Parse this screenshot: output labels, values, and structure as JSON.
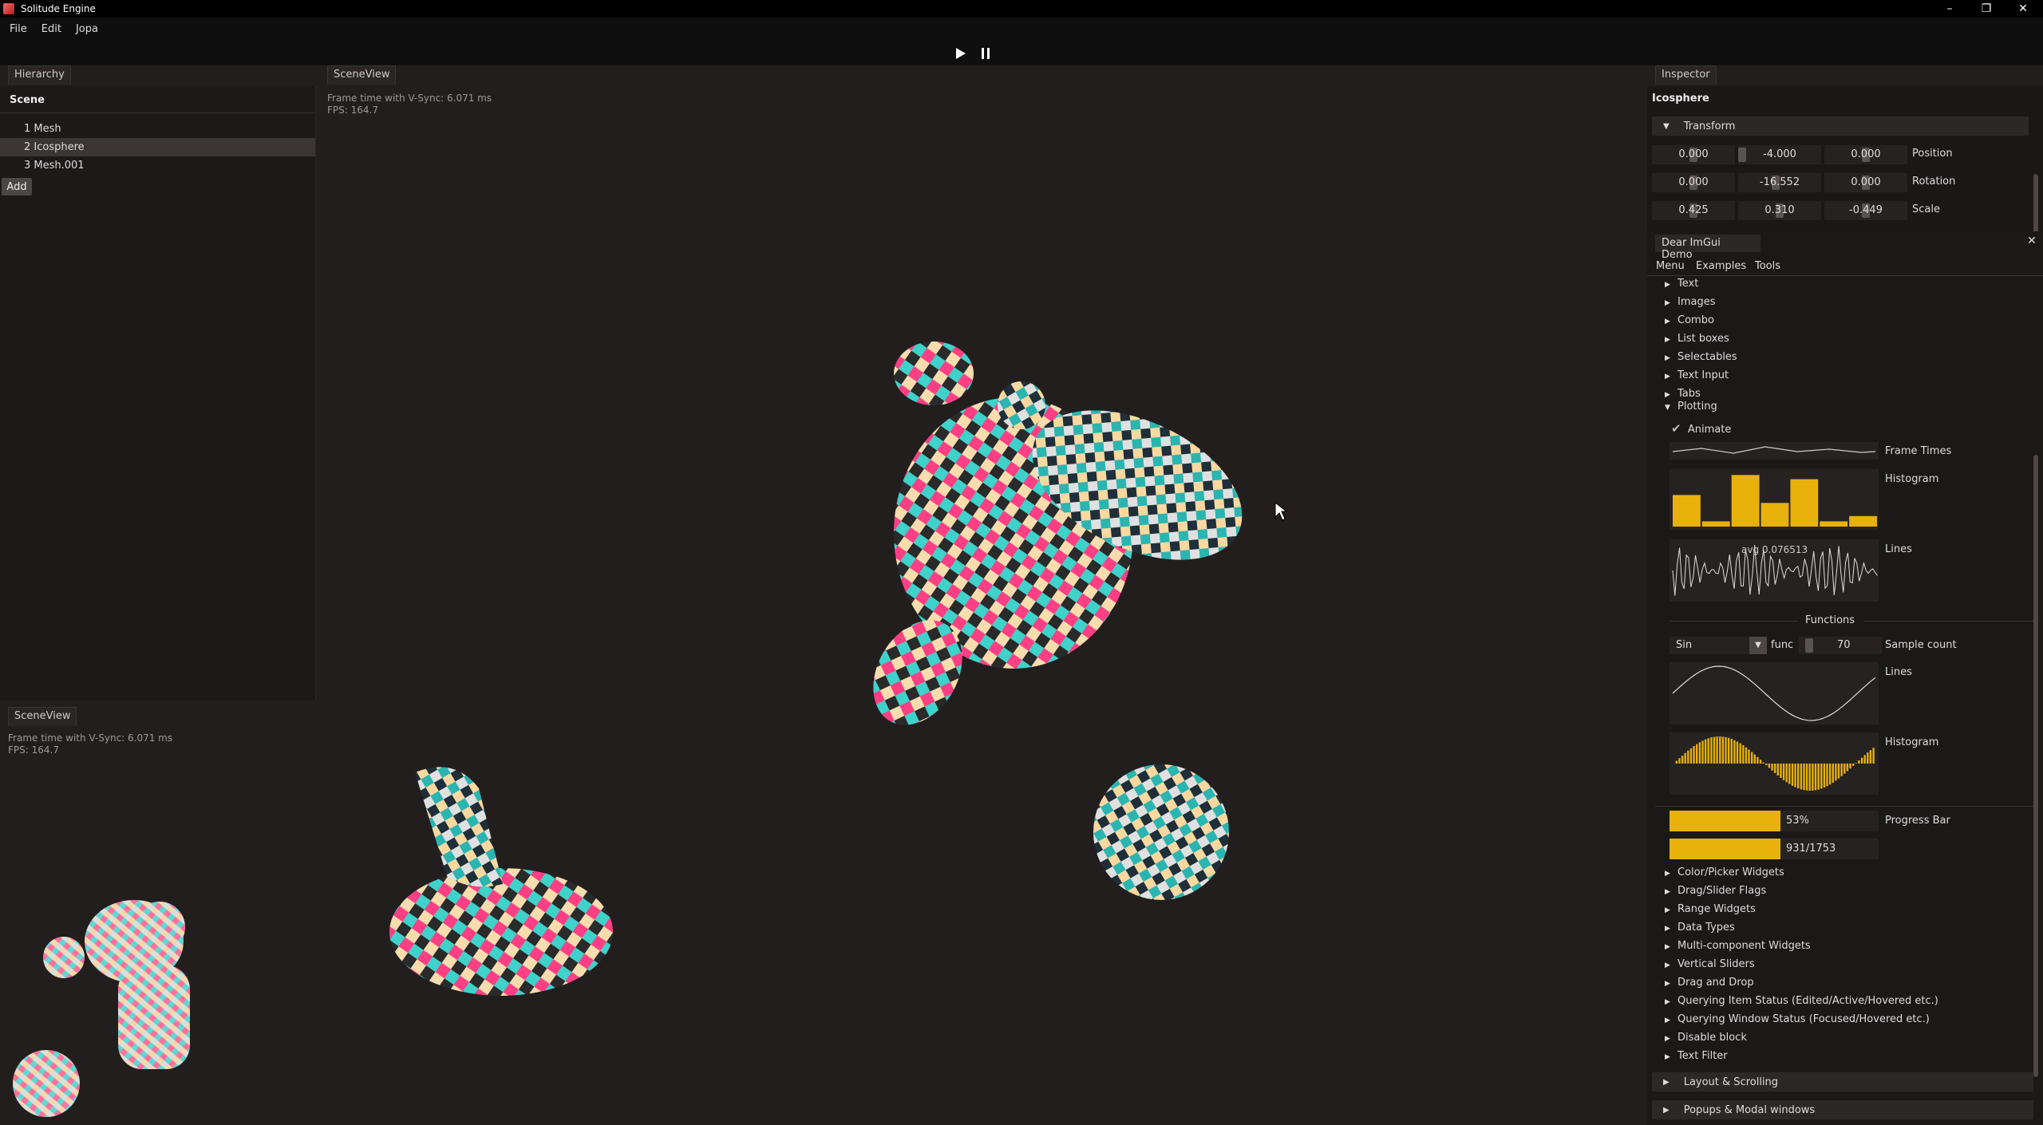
{
  "app": {
    "title": "Solitude Engine",
    "icons": {
      "minimize": "minimize-icon",
      "restore": "restore-icon",
      "close": "close-icon"
    }
  },
  "menu": {
    "file": "File",
    "edit": "Edit",
    "jopa": "Jopa"
  },
  "toolbar": {
    "play": "play-icon",
    "pause": "pause-icon"
  },
  "hierarchy": {
    "tab": "Hierarchy",
    "scene_label": "Scene",
    "items": [
      {
        "label": "1 Mesh"
      },
      {
        "label": "2 Icosphere"
      },
      {
        "label": "3 Mesh.001"
      }
    ],
    "add_label": "Add"
  },
  "sceneview": {
    "tab": "SceneView",
    "frame_time": "Frame time with V-Sync: 6.071 ms",
    "fps": "FPS: 164.7"
  },
  "miniview": {
    "tab": "SceneView",
    "frame_time": "Frame time with V-Sync: 6.071 ms",
    "fps": "FPS: 164.7"
  },
  "inspector": {
    "tab": "Inspector",
    "object_name": "Icosphere",
    "transform_label": "Transform",
    "position": {
      "label": "Position",
      "x": "0.000",
      "y": "-4.000",
      "z": "0.000"
    },
    "rotation": {
      "label": "Rotation",
      "x": "0.000",
      "y": "-16.552",
      "z": "0.000"
    },
    "scale": {
      "label": "Scale",
      "x": "0.425",
      "y": "0.310",
      "z": "-0.449"
    }
  },
  "demo": {
    "title": "Dear ImGui Demo",
    "menu": {
      "menu": "Menu",
      "examples": "Examples",
      "tools": "Tools"
    },
    "tree_top": [
      "Text",
      "Images",
      "Combo",
      "List boxes",
      "Selectables",
      "Text Input",
      "Tabs"
    ],
    "plotting": "Plotting",
    "animate": "Animate",
    "frame_times": "Frame Times",
    "histogram": "Histogram",
    "lines": "Lines",
    "lines_overlay": "avg 0.076513",
    "functions": "Functions",
    "func_combo": "Sin",
    "func_label": "func",
    "sample_count_value": "70",
    "sample_count_label": "Sample count",
    "lines2": "Lines",
    "histogram2": "Histogram",
    "progress_text": "53%",
    "progress_value": 0.53,
    "progress_label": "Progress Bar",
    "progress2_text": "931/1753",
    "progress2_value": 0.531,
    "tree_bottom": [
      "Color/Picker Widgets",
      "Drag/Slider Flags",
      "Range Widgets",
      "Data Types",
      "Multi-component Widgets",
      "Vertical Sliders",
      "Drag and Drop",
      "Querying Item Status (Edited/Active/Hovered etc.)",
      "Querying Window Status (Focused/Hovered etc.)",
      "Disable block",
      "Text Filter"
    ],
    "layout_scrolling": "Layout & Scrolling",
    "popups_modal": "Popups & Modal windows",
    "close_icon": "close-icon",
    "accent": "#e8b10c"
  }
}
